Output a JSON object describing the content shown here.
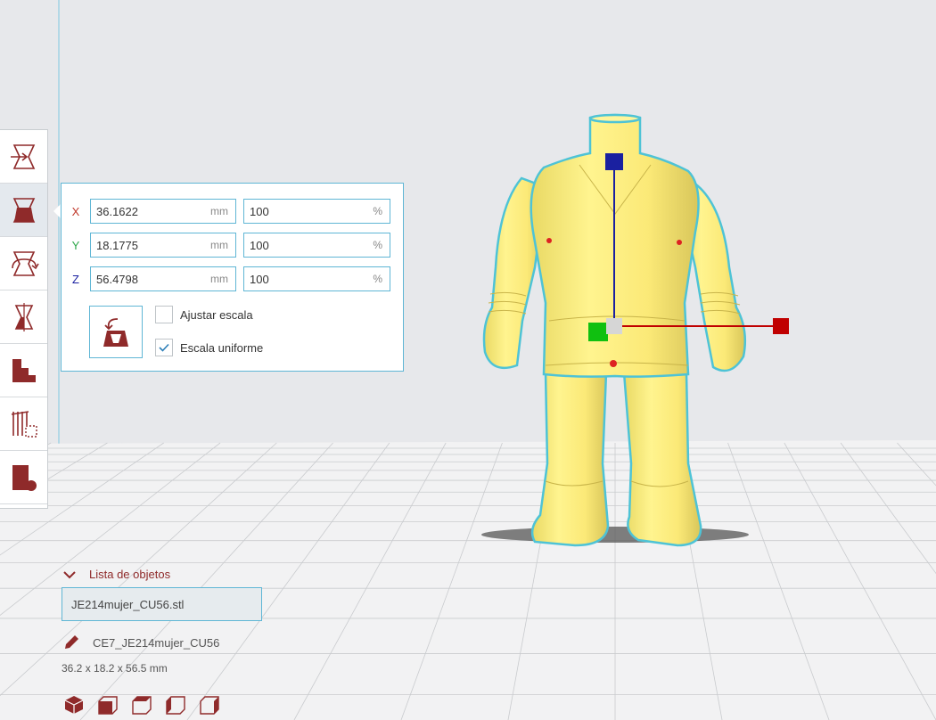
{
  "scale_panel": {
    "x": {
      "label": "X",
      "value": "36.1622",
      "unit": "mm",
      "percent": "100",
      "percent_unit": "%"
    },
    "y": {
      "label": "Y",
      "value": "18.1775",
      "unit": "mm",
      "percent": "100",
      "percent_unit": "%"
    },
    "z": {
      "label": "Z",
      "value": "56.4798",
      "unit": "mm",
      "percent": "100",
      "percent_unit": "%"
    },
    "fit_label": "Ajustar escala",
    "fit_checked": false,
    "uniform_label": "Escala uniforme",
    "uniform_checked": true
  },
  "toolbar": {
    "tools": [
      {
        "name": "move-tool-icon"
      },
      {
        "name": "scale-tool-icon",
        "active": true
      },
      {
        "name": "rotate-tool-icon"
      },
      {
        "name": "mirror-tool-icon"
      },
      {
        "name": "per-model-settings-icon"
      },
      {
        "name": "support-blocker-icon"
      },
      {
        "name": "custom-support-icon"
      }
    ]
  },
  "object_list": {
    "title": "Lista de objetos",
    "items": [
      "JE214mujer_CU56.stl"
    ],
    "selected_name": "CE7_JE214mujer_CU56",
    "dimensions": "36.2 x 18.2 x 56.5 mm"
  },
  "colors": {
    "accent": "#5fb6d5",
    "brand": "#8f2a2a",
    "model": "#ffed7e",
    "x_axis": "#c00000",
    "y_axis": "#0a9e1a",
    "z_axis": "#1a20a0",
    "axis_labels": {
      "x": "#c0392b",
      "y": "#2ea84a",
      "z": "#1a20a0"
    }
  },
  "view_buttons": [
    "3d-view-icon",
    "front-view-icon",
    "top-view-icon",
    "left-view-icon",
    "right-view-icon"
  ]
}
